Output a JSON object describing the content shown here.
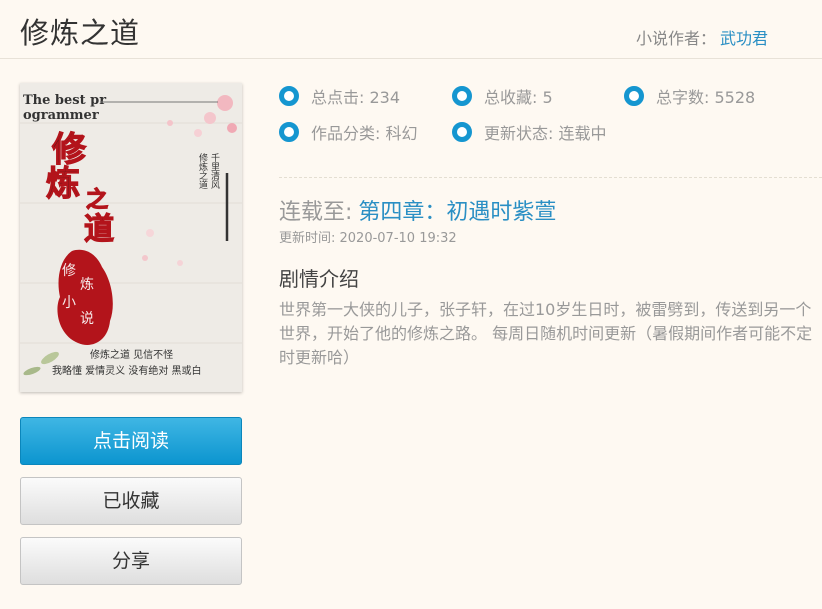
{
  "header": {
    "title": "修炼之道",
    "author_label": "小说作者：",
    "author_name": "武功君"
  },
  "cover": {
    "top_text_1": "The best pr",
    "top_text_2": "ogrammer",
    "title_chars": [
      "修",
      "炼",
      "之",
      "道"
    ],
    "seal_chars": [
      "修",
      "炼",
      "小",
      "说"
    ],
    "bottom_line_1": "修炼之道 见信不怪",
    "bottom_line_2": "我略懂 爱情灵义 没有绝对 黑或白",
    "right_col_1": "修炼之道",
    "right_col_2": "千里清风"
  },
  "buttons": {
    "read": "点击阅读",
    "favorited": "已收藏",
    "share": "分享"
  },
  "stats": {
    "clicks": "总点击: 234",
    "favorites": "总收藏: 5",
    "word_count": "总字数: 5528",
    "category": "作品分类: 科幻",
    "status": "更新状态: 连载中"
  },
  "latest": {
    "label": "连载至:",
    "chapter": "第四章：初遇时紫萱",
    "updated": "更新时间: 2020-07-10 19:32"
  },
  "synopsis": {
    "title": "剧情介绍",
    "text": "世界第一大侠的儿子，张子轩，在过10岁生日时，被雷劈到，传送到另一个世界，开始了他的修炼之路。 每周日随机时间更新（暑假期间作者可能不定时更新哈）"
  },
  "colors": {
    "accent": "#2a8fc4",
    "ring": "#1596d0",
    "read_button": "#0c95cf",
    "seal_red": "#b3141b"
  }
}
